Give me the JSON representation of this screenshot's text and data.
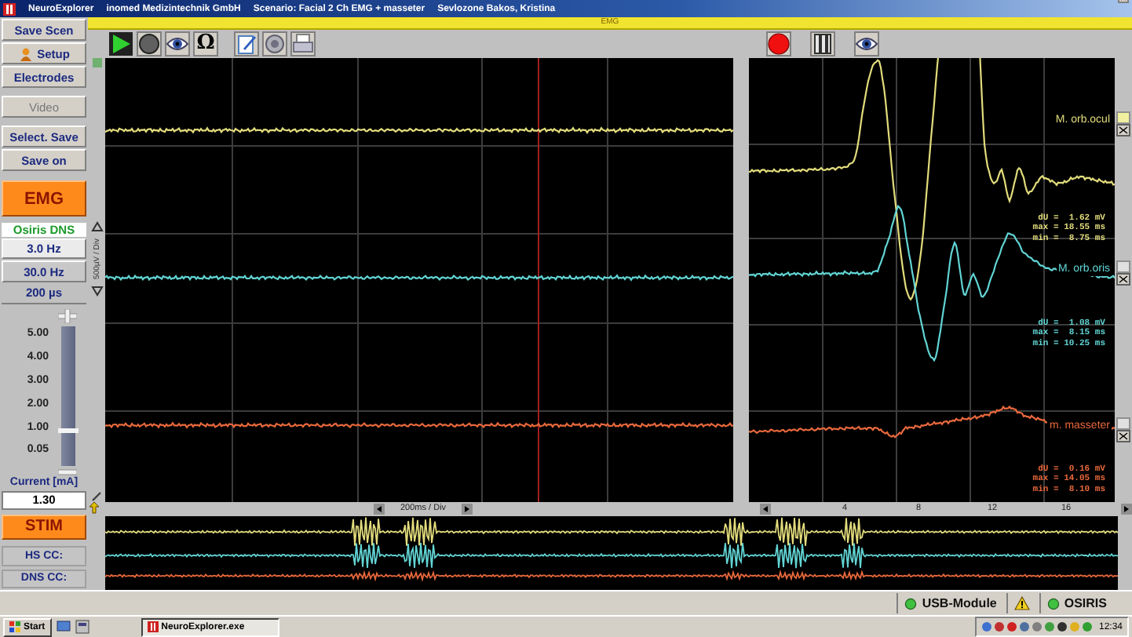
{
  "title_bar": {
    "app_name": "NeuroExplorer",
    "company": "inomed Medizintechnik GmbH",
    "scenario": "Scenario: Facial 2 Ch EMG + masseter",
    "patient": "Sevlozone Bakos, Kristina"
  },
  "sidebar": {
    "button_groups": [
      {
        "buttons": [
          {
            "kind": "plain",
            "label": "Save Scen",
            "disabled": false
          },
          {
            "kind": "icon",
            "label": "Setup",
            "disabled": false
          },
          {
            "kind": "plain",
            "label": "Electrodes",
            "disabled": false
          }
        ]
      },
      {
        "buttons": [
          {
            "kind": "plain",
            "label": "Video",
            "disabled": true
          }
        ]
      },
      {
        "buttons": [
          {
            "kind": "plain",
            "label": "Select. Save",
            "disabled": false
          },
          {
            "kind": "plain",
            "label": "Save on",
            "disabled": false
          }
        ]
      }
    ],
    "mode_button": "EMG",
    "device": "Osiris DNS",
    "rates": [
      {
        "label": "3.0 Hz",
        "selected": true
      },
      {
        "label": "30.0 Hz",
        "selected": false
      }
    ],
    "pulse_width": "200 µs",
    "current_slider": {
      "ticks": [
        "5.00",
        "4.00",
        "3.00",
        "2.00",
        "1.00",
        "0.05"
      ],
      "level": 0.25
    },
    "current_label": "Current [mA]",
    "current_value": "1.30",
    "stim_button": "STIM",
    "counters": [
      "HS CC:",
      "DNS CC:"
    ]
  },
  "main": {
    "panel_title": "EMG",
    "toolbar_left": [
      {
        "kind": "play"
      },
      {
        "kind": "circle"
      },
      {
        "kind": "eye"
      },
      {
        "kind": "glyph",
        "text": "Ω"
      },
      {
        "kind": "pencil"
      },
      {
        "kind": "speaker"
      },
      {
        "kind": "printer"
      }
    ],
    "toolbar_right": [
      {
        "kind": "record"
      },
      {
        "kind": "bars"
      },
      {
        "kind": "eye"
      }
    ],
    "y_scale": "500µV / Div",
    "x_scale": "200ms / Div",
    "channels": [
      {
        "name": "M. orb.ocul",
        "color": "#e2dc7c",
        "readings": [
          "dU =  1.62 mV",
          "max = 18.55 ms",
          "min =  8.75 ms"
        ]
      },
      {
        "name": "M. orb.oris",
        "color": "#62d4d4",
        "readings": [
          "dU =  1.08 mV",
          "max =  8.15 ms",
          "min = 10.25 ms"
        ]
      },
      {
        "name": "m. masseter",
        "color": "#e8683c",
        "readings": [
          "dU =  0.16 mV",
          "max = 14.05 ms",
          "min =  8.10 ms"
        ]
      }
    ],
    "right_ticks": [
      "4",
      "8",
      "12",
      "16"
    ]
  },
  "status_bar": {
    "items": [
      "USB-Module",
      "OSIRIS"
    ]
  },
  "taskbar": {
    "start": "Start",
    "task": "NeuroExplorer.exe",
    "clock": "12:34"
  }
}
